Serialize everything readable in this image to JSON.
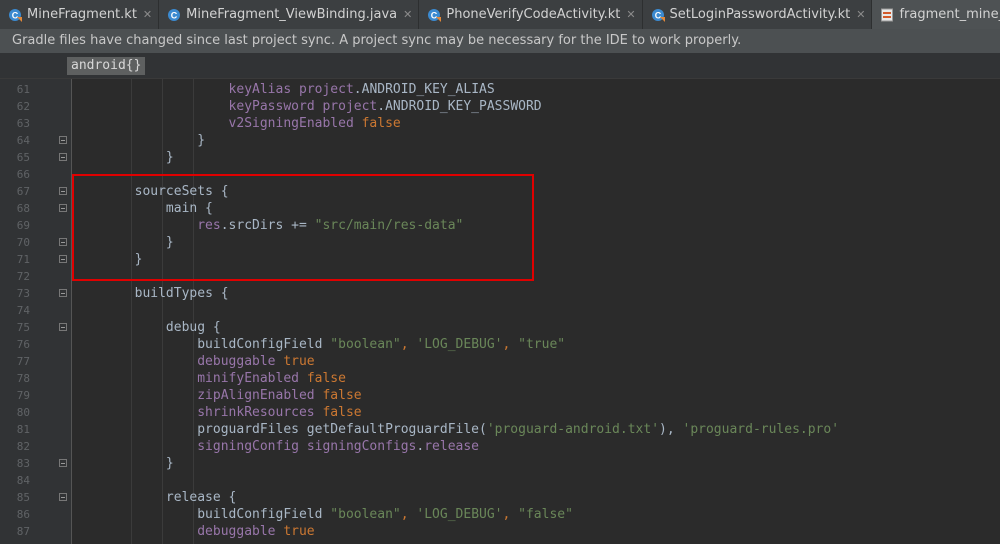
{
  "tabs": [
    {
      "label": "MineFragment.kt",
      "icon": "kotlin-class-icon",
      "active": false,
      "closable": true
    },
    {
      "label": "MineFragment_ViewBinding.java",
      "icon": "java-class-icon",
      "active": false,
      "closable": true
    },
    {
      "label": "PhoneVerifyCodeActivity.kt",
      "icon": "kotlin-class-icon",
      "active": false,
      "closable": true
    },
    {
      "label": "SetLoginPasswordActivity.kt",
      "icon": "kotlin-class-icon",
      "active": false,
      "closable": true
    },
    {
      "label": "fragment_mine_layout.xml",
      "icon": "xml-layout-icon",
      "active": true,
      "closable": false
    }
  ],
  "banner": {
    "text": "Gradle files have changed since last project sync. A project sync may be necessary for the IDE to work properly."
  },
  "breadcrumb": {
    "label": "android{}"
  },
  "colors": {
    "background": "#2b2b2b",
    "keyword": "#cc7832",
    "identifier": "#9876aa",
    "string": "#6a8759",
    "plain": "#a9b7c6",
    "highlight_box": "#e00000"
  },
  "editor": {
    "lines": [
      {
        "n": "61",
        "indent": 16,
        "fold": false,
        "tokens": [
          {
            "t": "keyAlias ",
            "c": "id"
          },
          {
            "t": "project",
            "c": "id"
          },
          {
            "t": ".ANDROID_KEY_ALIAS",
            "c": "pl"
          }
        ]
      },
      {
        "n": "62",
        "indent": 16,
        "fold": false,
        "tokens": [
          {
            "t": "keyPassword ",
            "c": "id"
          },
          {
            "t": "project",
            "c": "id"
          },
          {
            "t": ".ANDROID_KEY_PASSWORD",
            "c": "pl"
          }
        ]
      },
      {
        "n": "63",
        "indent": 16,
        "fold": false,
        "tokens": [
          {
            "t": "v2SigningEnabled ",
            "c": "id"
          },
          {
            "t": "false",
            "c": "kw"
          }
        ]
      },
      {
        "n": "64",
        "indent": 12,
        "fold": true,
        "tokens": [
          {
            "t": "}",
            "c": "pl"
          }
        ]
      },
      {
        "n": "65",
        "indent": 8,
        "fold": true,
        "tokens": [
          {
            "t": "}",
            "c": "pl"
          }
        ]
      },
      {
        "n": "66",
        "indent": 0,
        "fold": false,
        "tokens": []
      },
      {
        "n": "67",
        "indent": 4,
        "fold": true,
        "tokens": [
          {
            "t": "sourceSets {",
            "c": "pl"
          }
        ]
      },
      {
        "n": "68",
        "indent": 8,
        "fold": true,
        "tokens": [
          {
            "t": "main {",
            "c": "pl"
          }
        ]
      },
      {
        "n": "69",
        "indent": 12,
        "fold": false,
        "tokens": [
          {
            "t": "res",
            "c": "id"
          },
          {
            "t": ".srcDirs += ",
            "c": "pl"
          },
          {
            "t": "\"src/main/res-data\"",
            "c": "str"
          }
        ]
      },
      {
        "n": "70",
        "indent": 8,
        "fold": true,
        "tokens": [
          {
            "t": "}",
            "c": "pl"
          }
        ]
      },
      {
        "n": "71",
        "indent": 4,
        "fold": true,
        "tokens": [
          {
            "t": "}",
            "c": "pl"
          }
        ]
      },
      {
        "n": "72",
        "indent": 0,
        "fold": false,
        "tokens": []
      },
      {
        "n": "73",
        "indent": 4,
        "fold": true,
        "tokens": [
          {
            "t": "buildTypes {",
            "c": "pl"
          }
        ]
      },
      {
        "n": "74",
        "indent": 0,
        "fold": false,
        "tokens": []
      },
      {
        "n": "75",
        "indent": 8,
        "fold": true,
        "tokens": [
          {
            "t": "debug {",
            "c": "pl"
          }
        ]
      },
      {
        "n": "76",
        "indent": 12,
        "fold": false,
        "tokens": [
          {
            "t": "buildConfigField ",
            "c": "pl"
          },
          {
            "t": "\"boolean\"",
            "c": "str"
          },
          {
            "t": ", ",
            "c": "kw"
          },
          {
            "t": "'LOG_DEBUG'",
            "c": "str"
          },
          {
            "t": ", ",
            "c": "kw"
          },
          {
            "t": "\"true\"",
            "c": "str"
          }
        ]
      },
      {
        "n": "77",
        "indent": 12,
        "fold": false,
        "tokens": [
          {
            "t": "debuggable ",
            "c": "id"
          },
          {
            "t": "true",
            "c": "kw"
          }
        ]
      },
      {
        "n": "78",
        "indent": 12,
        "fold": false,
        "tokens": [
          {
            "t": "minifyEnabled ",
            "c": "id"
          },
          {
            "t": "false",
            "c": "kw"
          }
        ]
      },
      {
        "n": "79",
        "indent": 12,
        "fold": false,
        "tokens": [
          {
            "t": "zipAlignEnabled ",
            "c": "id"
          },
          {
            "t": "false",
            "c": "kw"
          }
        ]
      },
      {
        "n": "80",
        "indent": 12,
        "fold": false,
        "tokens": [
          {
            "t": "shrinkResources ",
            "c": "id"
          },
          {
            "t": "false",
            "c": "kw"
          }
        ]
      },
      {
        "n": "81",
        "indent": 12,
        "fold": false,
        "tokens": [
          {
            "t": "proguardFiles getDefaultProguardFile(",
            "c": "pl"
          },
          {
            "t": "'proguard-android.txt'",
            "c": "str"
          },
          {
            "t": "), ",
            "c": "pl"
          },
          {
            "t": "'proguard-rules.pro'",
            "c": "str"
          }
        ]
      },
      {
        "n": "82",
        "indent": 12,
        "fold": false,
        "tokens": [
          {
            "t": "signingConfig ",
            "c": "id"
          },
          {
            "t": "signingConfigs",
            "c": "id"
          },
          {
            "t": ".",
            "c": "pl"
          },
          {
            "t": "release",
            "c": "id"
          }
        ]
      },
      {
        "n": "83",
        "indent": 8,
        "fold": true,
        "tokens": [
          {
            "t": "}",
            "c": "pl"
          }
        ]
      },
      {
        "n": "84",
        "indent": 0,
        "fold": false,
        "tokens": []
      },
      {
        "n": "85",
        "indent": 8,
        "fold": true,
        "tokens": [
          {
            "t": "release {",
            "c": "pl"
          }
        ]
      },
      {
        "n": "86",
        "indent": 12,
        "fold": false,
        "tokens": [
          {
            "t": "buildConfigField ",
            "c": "pl"
          },
          {
            "t": "\"boolean\"",
            "c": "str"
          },
          {
            "t": ", ",
            "c": "kw"
          },
          {
            "t": "'LOG_DEBUG'",
            "c": "str"
          },
          {
            "t": ", ",
            "c": "kw"
          },
          {
            "t": "\"false\"",
            "c": "str"
          }
        ]
      },
      {
        "n": "87",
        "indent": 12,
        "fold": false,
        "tokens": [
          {
            "t": "debuggable ",
            "c": "id"
          },
          {
            "t": "true",
            "c": "kw"
          }
        ]
      }
    ]
  }
}
